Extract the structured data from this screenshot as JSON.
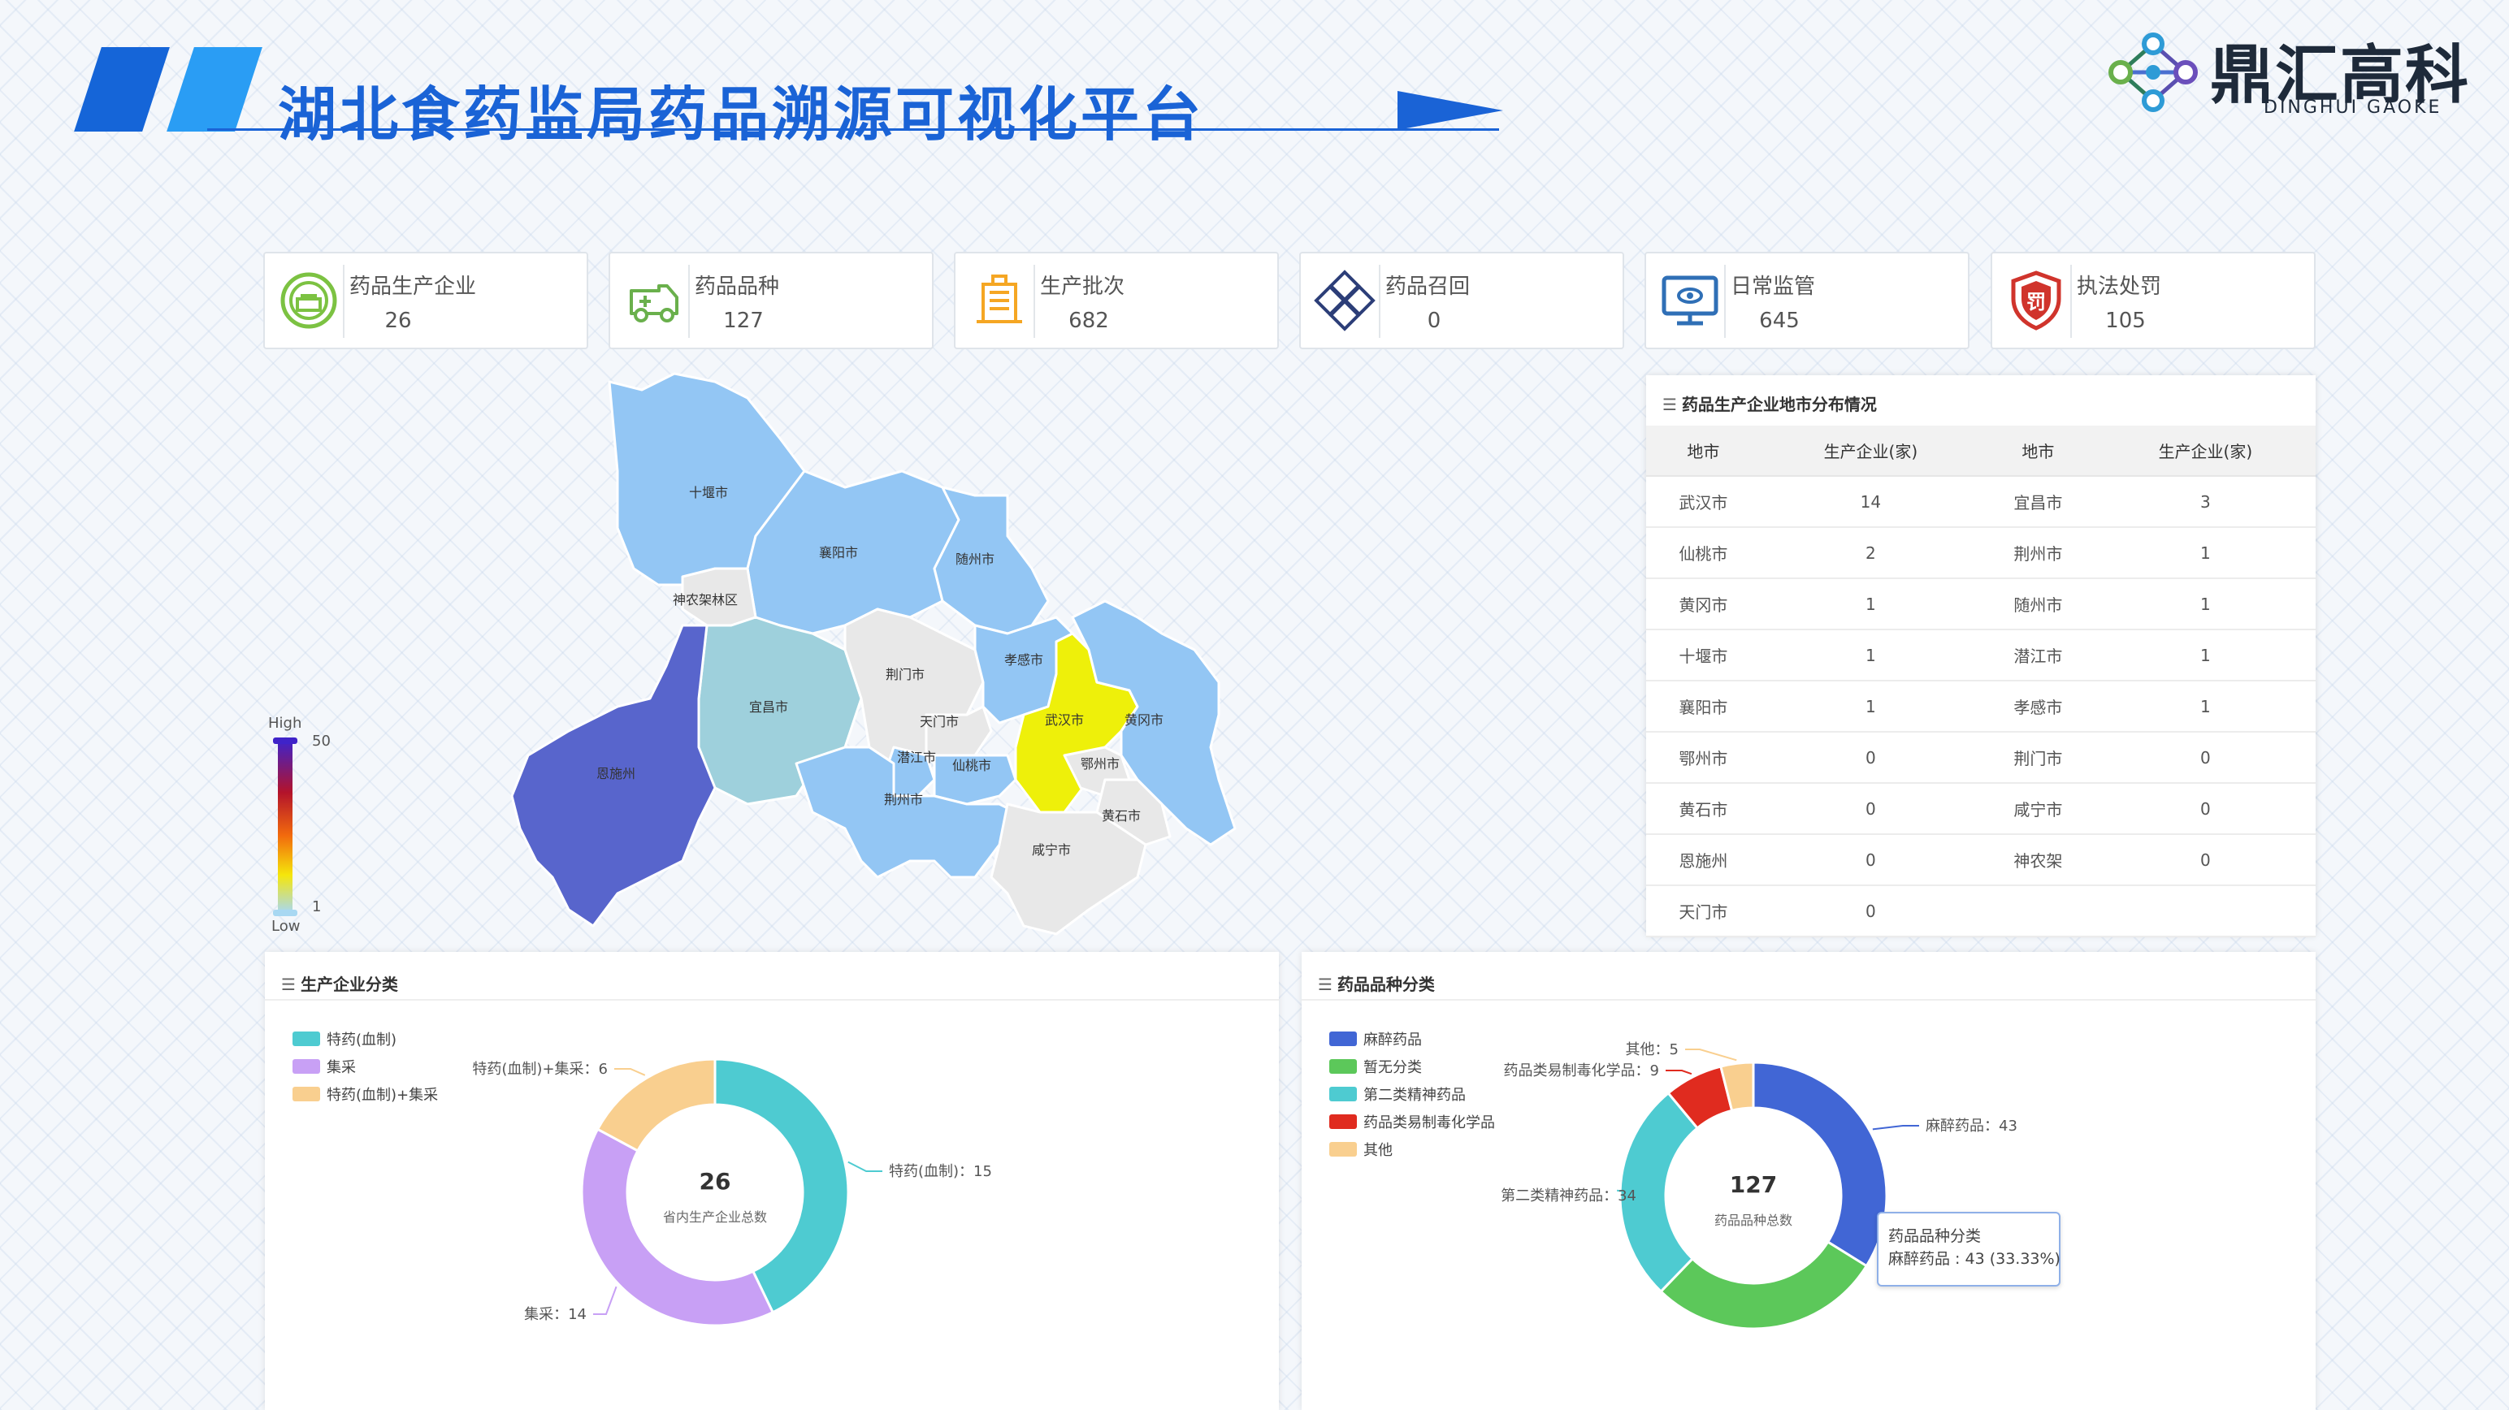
{
  "header": {
    "title": "湖北食药监局药品溯源可视化平台"
  },
  "logo": {
    "name": "鼎汇高科",
    "sub": "DINGHUI GAOKE"
  },
  "stats": [
    {
      "label": "药品生产企业",
      "value": "26",
      "icon": "factory-badge-icon",
      "color": "#7cc242"
    },
    {
      "label": "药品品种",
      "value": "127",
      "icon": "ambulance-icon",
      "color": "#6ab04c"
    },
    {
      "label": "生产批次",
      "value": "682",
      "icon": "building-icon",
      "color": "#f5a623"
    },
    {
      "label": "药品召回",
      "value": "0",
      "icon": "recall-grid-icon",
      "color": "#2c3e78"
    },
    {
      "label": "日常监管",
      "value": "645",
      "icon": "monitor-eye-icon",
      "color": "#2f6fb6"
    },
    {
      "label": "执法处罚",
      "value": "105",
      "icon": "penalty-shield-icon",
      "color": "#d0342c"
    }
  ],
  "map": {
    "legend_high": "High",
    "legend_low": "Low",
    "legend_max": "50",
    "legend_min": "1",
    "regions": [
      {
        "name": "十堰市",
        "value": 1,
        "color": "#93c6f4"
      },
      {
        "name": "襄阳市",
        "value": 1,
        "color": "#93c6f4"
      },
      {
        "name": "随州市",
        "value": 1,
        "color": "#93c6f4"
      },
      {
        "name": "神农架林区",
        "value": 0,
        "color": "#e8e8e8"
      },
      {
        "name": "宜昌市",
        "value": 3,
        "color": "#9ed0dc"
      },
      {
        "name": "荆门市",
        "value": 0,
        "color": "#e8e8e8"
      },
      {
        "name": "孝感市",
        "value": 1,
        "color": "#93c6f4"
      },
      {
        "name": "天门市",
        "value": 0,
        "color": "#e8e8e8"
      },
      {
        "name": "武汉市",
        "value": 14,
        "color": "#eef00a"
      },
      {
        "name": "黄冈市",
        "value": 1,
        "color": "#93c6f4"
      },
      {
        "name": "恩施州",
        "value": 0,
        "color": "#5865cc"
      },
      {
        "name": "潜江市",
        "value": 1,
        "color": "#93c6f4"
      },
      {
        "name": "仙桃市",
        "value": 2,
        "color": "#93c6f4"
      },
      {
        "name": "鄂州市",
        "value": 0,
        "color": "#e8e8e8"
      },
      {
        "name": "荆州市",
        "value": 1,
        "color": "#93c6f4"
      },
      {
        "name": "黄石市",
        "value": 0,
        "color": "#e8e8e8"
      },
      {
        "name": "咸宁市",
        "value": 0,
        "color": "#e8e8e8"
      }
    ]
  },
  "distribution": {
    "title": "药品生产企业地市分布情况",
    "headers": [
      "地市",
      "生产企业(家)",
      "地市",
      "生产企业(家)"
    ],
    "rows": [
      [
        "武汉市",
        "14",
        "宜昌市",
        "3"
      ],
      [
        "仙桃市",
        "2",
        "荆州市",
        "1"
      ],
      [
        "黄冈市",
        "1",
        "随州市",
        "1"
      ],
      [
        "十堰市",
        "1",
        "潜江市",
        "1"
      ],
      [
        "襄阳市",
        "1",
        "孝感市",
        "1"
      ],
      [
        "鄂州市",
        "0",
        "荆门市",
        "0"
      ],
      [
        "黄石市",
        "0",
        "咸宁市",
        "0"
      ],
      [
        "恩施州",
        "0",
        "神农架",
        "0"
      ],
      [
        "天门市",
        "0",
        "",
        ""
      ]
    ]
  },
  "chart_data": [
    {
      "type": "pie",
      "title": "生产企业分类",
      "center_value": "26",
      "center_label": "省内生产企业总数",
      "categories": [
        "特药(血制)",
        "集采",
        "特药(血制)+集采"
      ],
      "values": [
        15,
        14,
        6
      ],
      "colors": [
        "#4ecbd1",
        "#c8a0f5",
        "#f9cf8f"
      ],
      "data_labels": [
        "特药(血制)：15",
        "集采：14",
        "特药(血制)+集采：6"
      ],
      "legend_position": "top-left"
    },
    {
      "type": "pie",
      "title": "药品品种分类",
      "center_value": "127",
      "center_label": "药品品种总数",
      "categories": [
        "麻醉药品",
        "暂无分类",
        "第二类精神药品",
        "药品类易制毒化学品",
        "其他"
      ],
      "values": [
        43,
        36,
        34,
        9,
        5
      ],
      "colors": [
        "#4166d5",
        "#5cc85a",
        "#4ecbd1",
        "#e02b1f",
        "#f9cf8f"
      ],
      "data_labels": [
        "麻醉药品：43",
        "",
        "第二类精神药品：34",
        "药品类易制毒化学品：9",
        "其他：5"
      ],
      "legend_position": "top-left",
      "tooltip": {
        "title": "药品品种分类",
        "line": "麻醉药品 : 43 (33.33%)"
      }
    }
  ]
}
